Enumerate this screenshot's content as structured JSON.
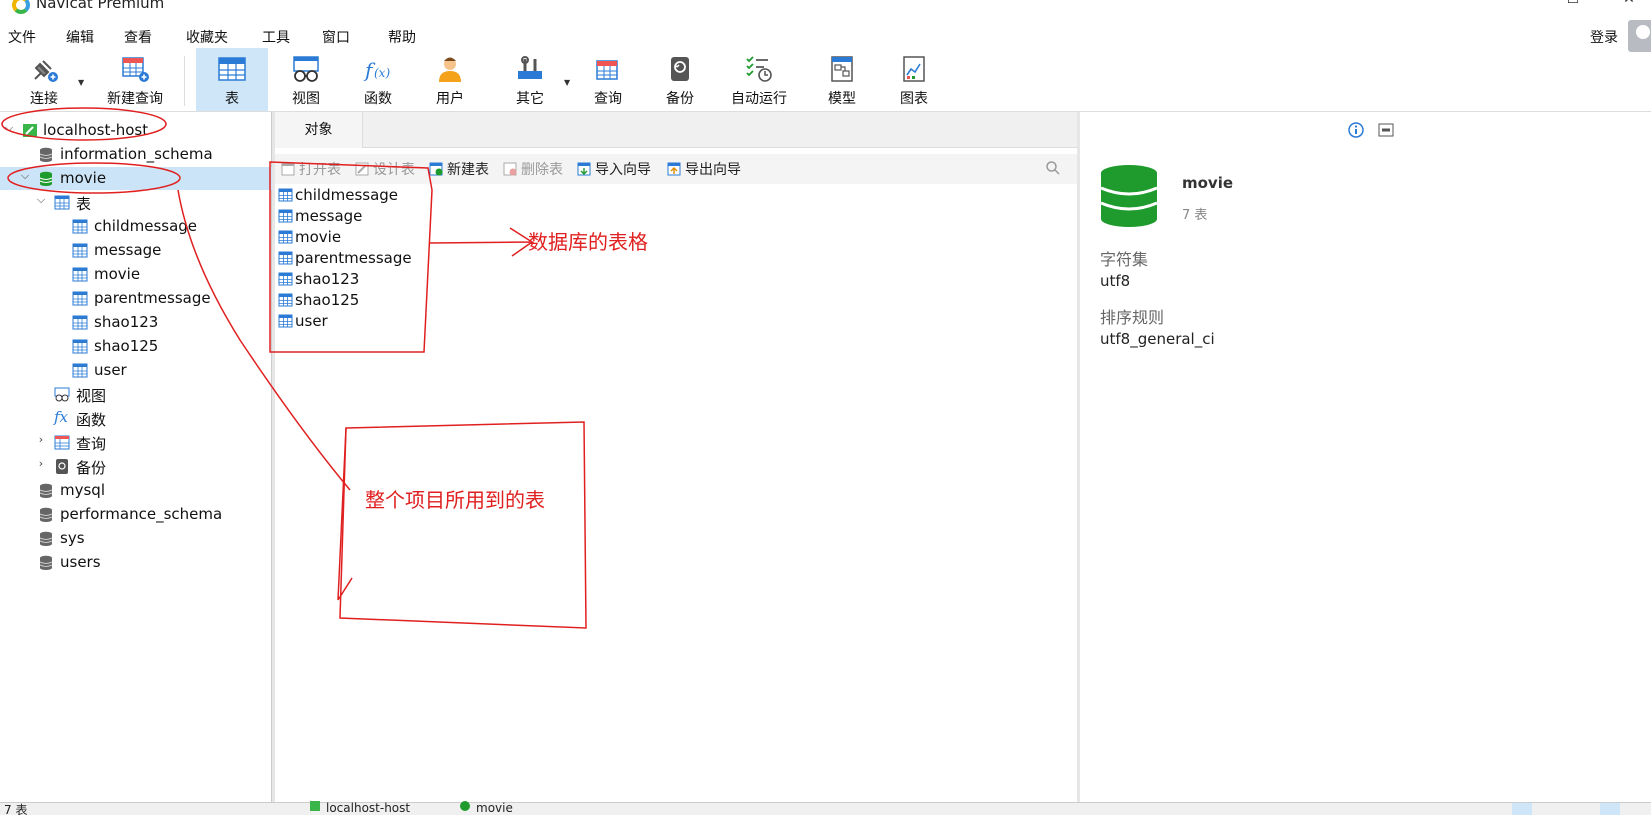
{
  "window": {
    "title": "Navicat Premium"
  },
  "menu": [
    "文件",
    "编辑",
    "查看",
    "收藏夹",
    "工具",
    "窗口",
    "帮助"
  ],
  "account": {
    "login_label": "登录"
  },
  "toolbar": {
    "buttons": [
      {
        "label": "连接",
        "icon": "plug-icon",
        "has_dropdown": true
      },
      {
        "label": "新建查询",
        "icon": "new-query-icon"
      },
      {
        "label": "表",
        "icon": "table-icon",
        "active": true
      },
      {
        "label": "视图",
        "icon": "view-icon"
      },
      {
        "label": "函数",
        "icon": "function-icon"
      },
      {
        "label": "用户",
        "icon": "user-icon"
      },
      {
        "label": "其它",
        "icon": "tools-icon",
        "has_dropdown": true
      },
      {
        "label": "查询",
        "icon": "query-icon"
      },
      {
        "label": "备份",
        "icon": "backup-icon"
      },
      {
        "label": "自动运行",
        "icon": "schedule-icon"
      },
      {
        "label": "模型",
        "icon": "model-icon"
      },
      {
        "label": "图表",
        "icon": "chart-icon"
      }
    ]
  },
  "tree": {
    "connection": "localhost-host",
    "databases_before": [
      "information_schema"
    ],
    "selected_db": "movie",
    "tables_group": "表",
    "tables": [
      "childmessage",
      "message",
      "movie",
      "parentmessage",
      "shao123",
      "shao125",
      "user"
    ],
    "views_group": "视图",
    "functions_group": "函数",
    "queries_group": "查询",
    "backups_group": "备份",
    "databases_after": [
      "mysql",
      "performance_schema",
      "sys",
      "users"
    ]
  },
  "center": {
    "tab_label": "对象",
    "actions": {
      "open": "打开表",
      "design": "设计表",
      "new": "新建表",
      "delete": "删除表",
      "import": "导入向导",
      "export": "导出向导"
    },
    "objects": [
      "childmessage",
      "message",
      "movie",
      "parentmessage",
      "shao123",
      "shao125",
      "user"
    ]
  },
  "info": {
    "db_name": "movie",
    "table_count": "7 表",
    "charset_label": "字符集",
    "charset_value": "utf8",
    "collation_label": "排序规则",
    "collation_value": "utf8_general_ci"
  },
  "statusbar": {
    "left": "7 表",
    "connection": "localhost-host",
    "database": "movie"
  },
  "annotations": {
    "tables_note": "数据库的表格",
    "project_note": "整个项目所用到的表"
  },
  "colors": {
    "accent_selected": "#cce4f7",
    "db_green": "#1f9b2e",
    "annotation_red": "#e02020",
    "table_blue": "#2b7bd6"
  }
}
